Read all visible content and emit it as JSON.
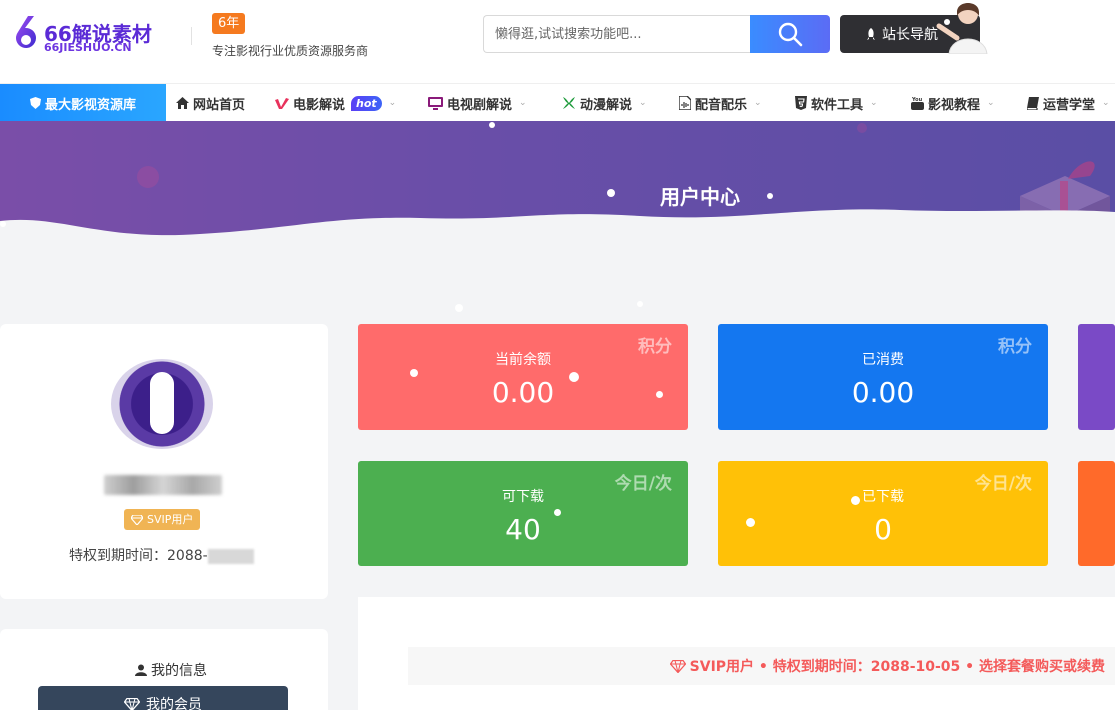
{
  "header": {
    "logo_title": "66解说素材",
    "logo_sub": "66JIESHUO.CN",
    "years_badge": "6年",
    "slogan": "专注影视行业优质资源服务商",
    "search_placeholder": "懒得逛,试试搜索功能吧...",
    "site_nav_label": "站长导航"
  },
  "nav": {
    "primary": "最大影视资源库",
    "items": [
      {
        "label": "网站首页",
        "icon": "home-icon"
      },
      {
        "label": "电影解说",
        "icon": "vimeo-icon",
        "badge": "hot"
      },
      {
        "label": "电视剧解说",
        "icon": "tv-icon"
      },
      {
        "label": "动漫解说",
        "icon": "xbox-icon"
      },
      {
        "label": "配音配乐",
        "icon": "audio-file-icon"
      },
      {
        "label": "软件工具",
        "icon": "html5-icon"
      },
      {
        "label": "影视教程",
        "icon": "youtube-icon"
      },
      {
        "label": "运营学堂",
        "icon": "book-icon"
      }
    ]
  },
  "banner": {
    "title": "用户中心"
  },
  "profile": {
    "vip_badge": "SVIP用户",
    "expire_label": "特权到期时间：2088-"
  },
  "menu": {
    "title": "我的信息",
    "active_item": "我的会员"
  },
  "stats": [
    {
      "label": "当前余额",
      "value": "0.00",
      "tag": "积分",
      "color": "#ff6b6b"
    },
    {
      "label": "已消费",
      "value": "0.00",
      "tag": "积分",
      "color": "#1477f0"
    },
    {
      "label": "可下载",
      "value": "40",
      "tag": "今日/次",
      "color": "#4caf50"
    },
    {
      "label": "已下载",
      "value": "0",
      "tag": "今日/次",
      "color": "#ffc107"
    }
  ],
  "partial_cards": {
    "top_color": "#7a4ac6",
    "bottom_color": "#ff6a2a"
  },
  "notice": "SVIP用户 • 特权到期时间：2088-10-05 • 选择套餐购买或续费",
  "colors": {
    "accent": "#1a8cff",
    "brand": "#5b2bd6",
    "banner": "#6a4ea8"
  }
}
